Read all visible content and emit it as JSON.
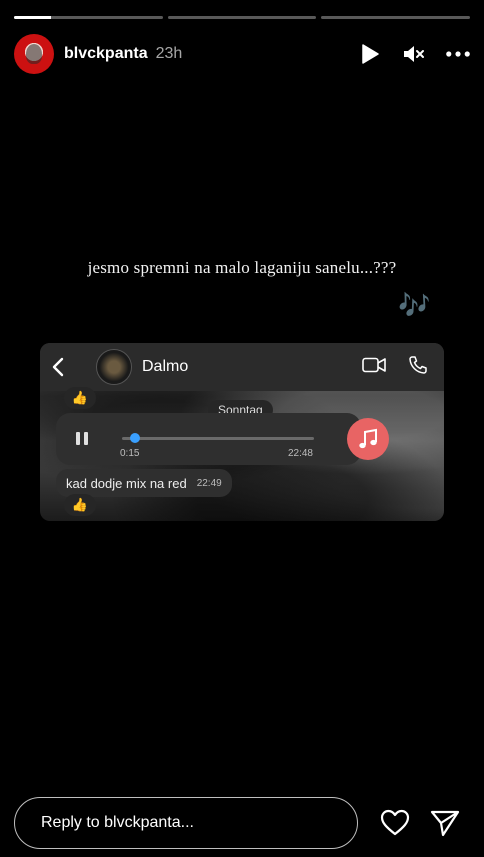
{
  "story": {
    "segments": [
      1,
      0,
      0
    ],
    "user": "blvckpanta",
    "time": "23h",
    "icons": [
      "play-icon",
      "mute-icon",
      "more-icon"
    ]
  },
  "caption": "jesmo spremni na malo laganiju sanelu...???",
  "notes": "🎶",
  "chat": {
    "contact": "Dalmo",
    "day": "Sonntag",
    "reaction": "👍",
    "voice": {
      "elapsed": "0:15",
      "time": "22:48",
      "progress": 0.07
    },
    "message": {
      "text": "kad dodje mix na red",
      "time": "22:49"
    }
  },
  "reply": {
    "placeholder": "Reply to blvckpanta..."
  }
}
